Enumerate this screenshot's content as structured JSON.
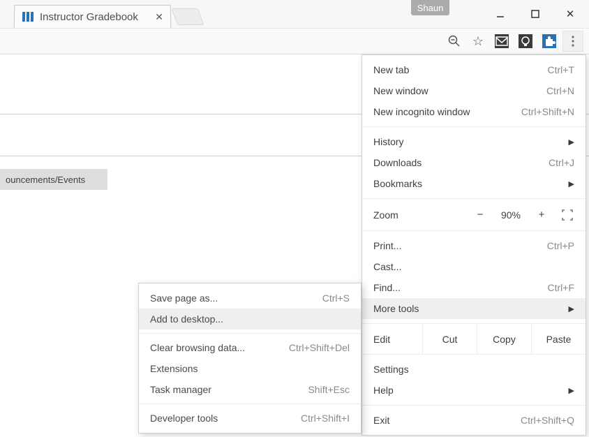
{
  "window": {
    "profile": "Shaun",
    "tab_title": "Instructor Gradebook"
  },
  "page": {
    "events_button": "ouncements/Events"
  },
  "menu": {
    "new_tab": {
      "label": "New tab",
      "shortcut": "Ctrl+T"
    },
    "new_window": {
      "label": "New window",
      "shortcut": "Ctrl+N"
    },
    "new_incognito": {
      "label": "New incognito window",
      "shortcut": "Ctrl+Shift+N"
    },
    "history": {
      "label": "History"
    },
    "downloads": {
      "label": "Downloads",
      "shortcut": "Ctrl+J"
    },
    "bookmarks": {
      "label": "Bookmarks"
    },
    "zoom": {
      "label": "Zoom",
      "value": "90%",
      "minus": "−",
      "plus": "+"
    },
    "print": {
      "label": "Print...",
      "shortcut": "Ctrl+P"
    },
    "cast": {
      "label": "Cast..."
    },
    "find": {
      "label": "Find...",
      "shortcut": "Ctrl+F"
    },
    "more_tools": {
      "label": "More tools"
    },
    "edit": {
      "label": "Edit",
      "cut": "Cut",
      "copy": "Copy",
      "paste": "Paste"
    },
    "settings": {
      "label": "Settings"
    },
    "help": {
      "label": "Help"
    },
    "exit": {
      "label": "Exit",
      "shortcut": "Ctrl+Shift+Q"
    }
  },
  "submenu": {
    "save_as": {
      "label": "Save page as...",
      "shortcut": "Ctrl+S"
    },
    "add_desktop": {
      "label": "Add to desktop..."
    },
    "clear_data": {
      "label": "Clear browsing data...",
      "shortcut": "Ctrl+Shift+Del"
    },
    "extensions": {
      "label": "Extensions"
    },
    "task_manager": {
      "label": "Task manager",
      "shortcut": "Shift+Esc"
    },
    "dev_tools": {
      "label": "Developer tools",
      "shortcut": "Ctrl+Shift+I"
    }
  }
}
